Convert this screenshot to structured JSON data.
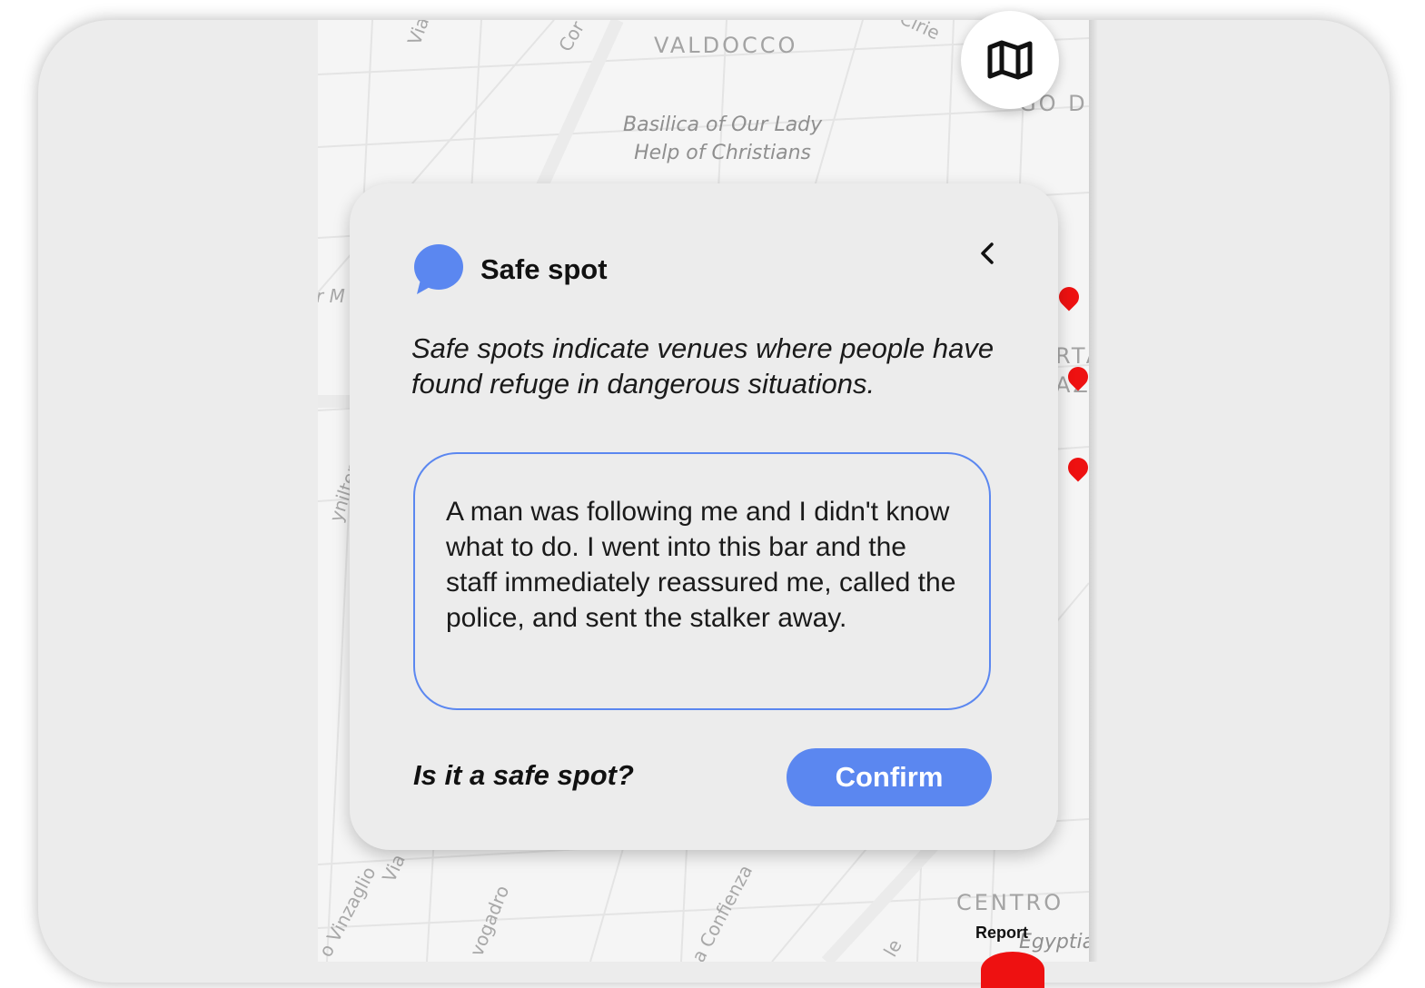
{
  "map": {
    "labels": {
      "district_top": "VALDOCCO",
      "poi_line1": "Basilica of Our Lady",
      "poi_line2": "Help of Christians",
      "district_bottom": "CENTRO",
      "street_via_top": "Via",
      "street_cor": "Cor",
      "street_cirie": "Cirie",
      "district_partial_right": "GO D",
      "partial_left": "r M",
      "street_vanchiglia": "ynilterra",
      "partial_right_rta": "RTA",
      "partial_right_az": "AZ",
      "street_vinzaglio": "o Vinzaglio",
      "street_via_bottom": "Via",
      "street_avogadro": "vogadro",
      "street_confienza": "a Confienza",
      "street_le": "le",
      "poi_egyptian": "Egyptia"
    },
    "pin_color": "#ee1111",
    "report_label": "Report",
    "map_toggle_icon": "map-icon"
  },
  "card": {
    "icon": "chat-bubble-icon",
    "title": "Safe spot",
    "description": "Safe spots indicate venues where people have found refuge in dangerous situations.",
    "story": "A man was following me and I didn't know what to do. I went into this bar and the staff immediately reassured me, called the police, and sent the stalker away.",
    "question": "Is it a safe spot?",
    "confirm_label": "Confirm",
    "back_icon": "chevron-left-icon"
  },
  "colors": {
    "accent": "#5b87f0",
    "card_bg": "#ececec",
    "map_bg": "#f5f5f5"
  }
}
